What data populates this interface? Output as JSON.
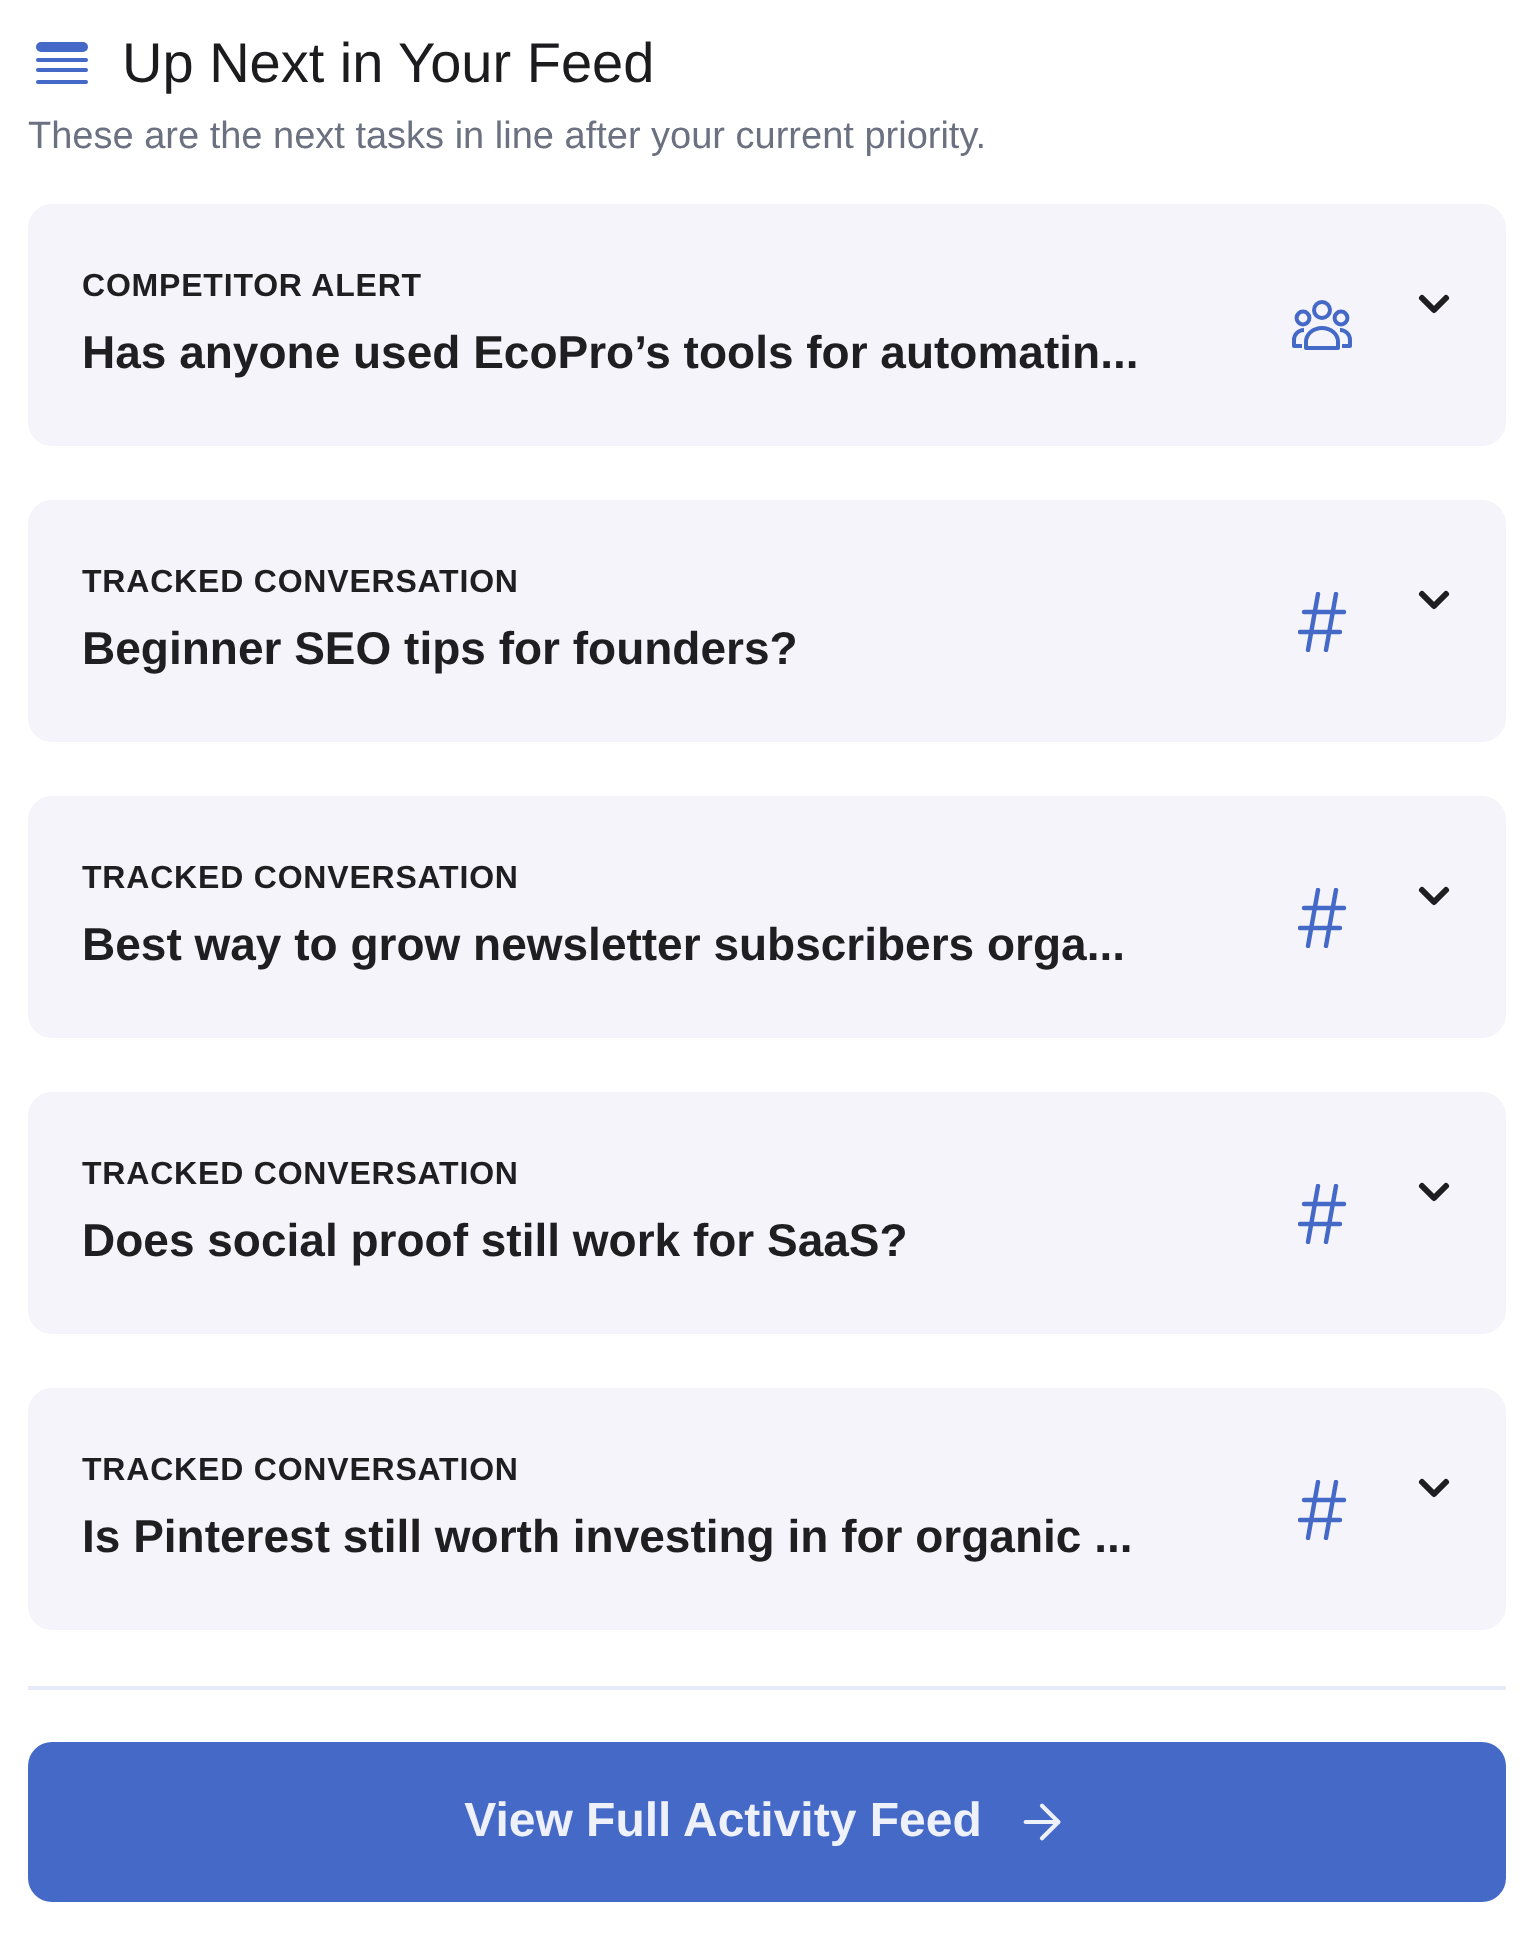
{
  "header": {
    "title": "Up Next in Your Feed",
    "subtitle": "These are the next tasks in line after your current priority."
  },
  "feed_items": [
    {
      "kind": "competitor",
      "label": "COMPETITOR ALERT",
      "title": "Has anyone used EcoPro’s tools for automatin...",
      "expanded": false
    },
    {
      "kind": "tracked",
      "label": "TRACKED CONVERSATION",
      "title": "Beginner SEO tips for founders?",
      "expanded": false
    },
    {
      "kind": "tracked",
      "label": "TRACKED CONVERSATION",
      "title": "Best way to grow newsletter subscribers orga...",
      "expanded": false
    },
    {
      "kind": "tracked",
      "label": "TRACKED CONVERSATION",
      "title": "Does social proof still work for SaaS?",
      "expanded": false
    },
    {
      "kind": "tracked",
      "label": "TRACKED CONVERSATION",
      "title": "Is Pinterest still worth investing in for organic ...",
      "expanded": false
    }
  ],
  "button": {
    "label": "View Full Activity Feed"
  }
}
